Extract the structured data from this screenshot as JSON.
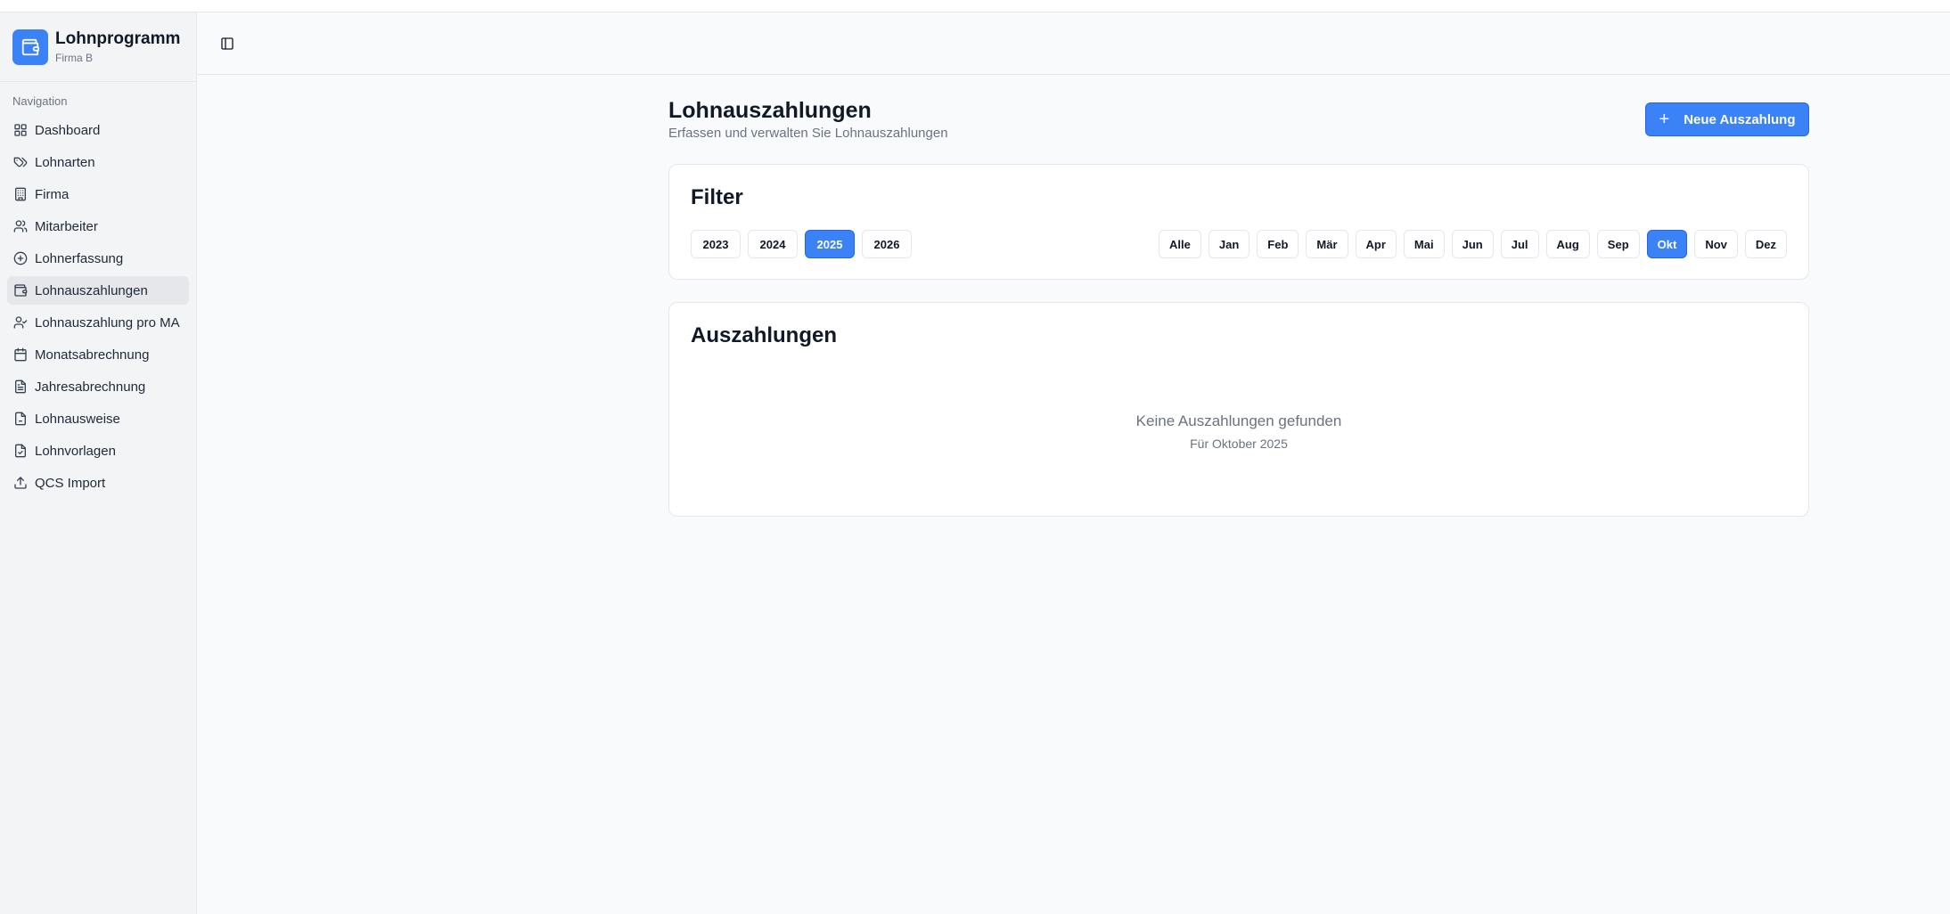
{
  "app": {
    "title": "Lohnprogramm",
    "company": "Firma B",
    "accent_color": "#3b82f6"
  },
  "sidebar": {
    "heading": "Navigation",
    "items": [
      {
        "label": "Dashboard",
        "icon": "grid-icon",
        "active": false
      },
      {
        "label": "Lohnarten",
        "icon": "tags-icon",
        "active": false
      },
      {
        "label": "Firma",
        "icon": "building-icon",
        "active": false
      },
      {
        "label": "Mitarbeiter",
        "icon": "users-icon",
        "active": false
      },
      {
        "label": "Lohnerfassung",
        "icon": "plus-circle-icon",
        "active": false
      },
      {
        "label": "Lohnauszahlungen",
        "icon": "wallet-icon",
        "active": true
      },
      {
        "label": "Lohnauszahlung pro MA",
        "icon": "user-check-icon",
        "active": false
      },
      {
        "label": "Monatsabrechnung",
        "icon": "calendar-icon",
        "active": false
      },
      {
        "label": "Jahresabrechnung",
        "icon": "file-text-icon",
        "active": false
      },
      {
        "label": "Lohnausweise",
        "icon": "file-icon",
        "active": false
      },
      {
        "label": "Lohnvorlagen",
        "icon": "file-check-icon",
        "active": false
      },
      {
        "label": "QCS Import",
        "icon": "upload-icon",
        "active": false
      }
    ]
  },
  "header": {
    "toggle_icon": "sidebar-toggle-icon"
  },
  "page": {
    "title": "Lohnauszahlungen",
    "subtitle": "Erfassen und verwalten Sie Lohnauszahlungen",
    "new_button_label": "Neue Auszahlung"
  },
  "filter": {
    "title": "Filter",
    "years": [
      "2023",
      "2024",
      "2025",
      "2026"
    ],
    "selected_year": "2025",
    "months": [
      "Alle",
      "Jan",
      "Feb",
      "Mär",
      "Apr",
      "Mai",
      "Jun",
      "Jul",
      "Aug",
      "Sep",
      "Okt",
      "Nov",
      "Dez"
    ],
    "selected_month": "Okt"
  },
  "payouts": {
    "title": "Auszahlungen",
    "empty_title": "Keine Auszahlungen gefunden",
    "empty_subtitle": "Für Oktober 2025"
  }
}
